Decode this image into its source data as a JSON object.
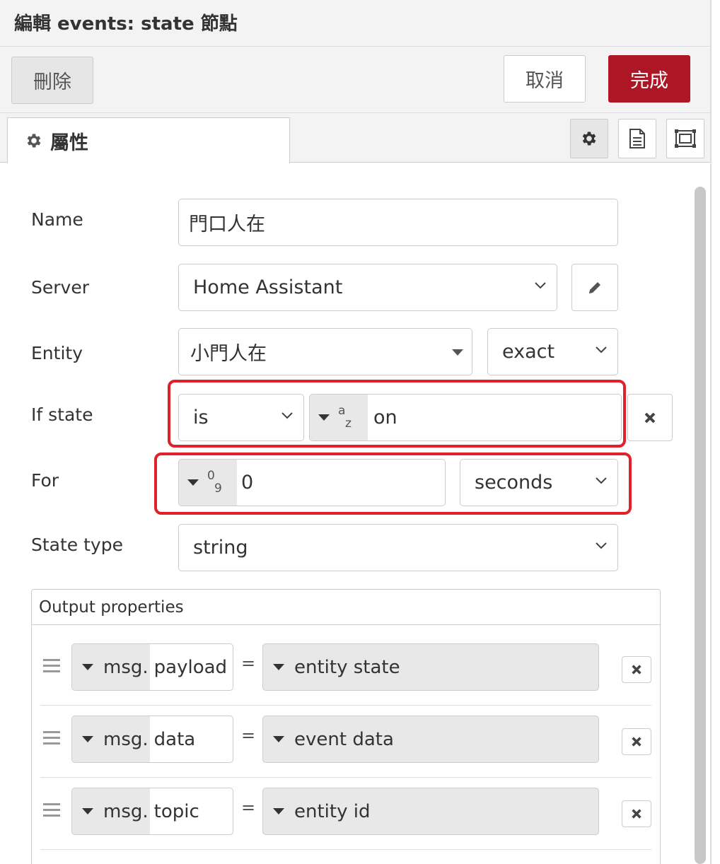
{
  "tray": {
    "title": "編輯 events: state 節點"
  },
  "toolbar": {
    "delete_label": "刪除",
    "cancel_label": "取消",
    "done_label": "完成"
  },
  "tabs": {
    "properties_label": "屬性"
  },
  "icons": {
    "tab": "gear-icon",
    "tab_buttons": [
      "gear-icon",
      "document-icon",
      "frame-icon"
    ]
  },
  "colors": {
    "accent": "#ad1625",
    "highlight": "#e0202a"
  },
  "form": {
    "name": {
      "label": "Name",
      "value": "門口人在"
    },
    "server": {
      "label": "Server",
      "value": "Home Assistant"
    },
    "entity": {
      "label": "Entity",
      "value": "小門人在",
      "match": "exact"
    },
    "if_state": {
      "label": "If state",
      "operator": "is",
      "type_a": "a",
      "type_b": "z",
      "value": "on"
    },
    "for": {
      "label": "For",
      "type_a": "0",
      "type_b": "9",
      "value": "0",
      "unit": "seconds"
    },
    "state_type": {
      "label": "State type",
      "value": "string"
    }
  },
  "output": {
    "title": "Output properties",
    "rows": [
      {
        "prefix": "msg.",
        "property": "payload",
        "eq": "=",
        "value": "entity state"
      },
      {
        "prefix": "msg.",
        "property": "data",
        "eq": "=",
        "value": "event data"
      },
      {
        "prefix": "msg.",
        "property": "topic",
        "eq": "=",
        "value": "entity id"
      }
    ]
  }
}
